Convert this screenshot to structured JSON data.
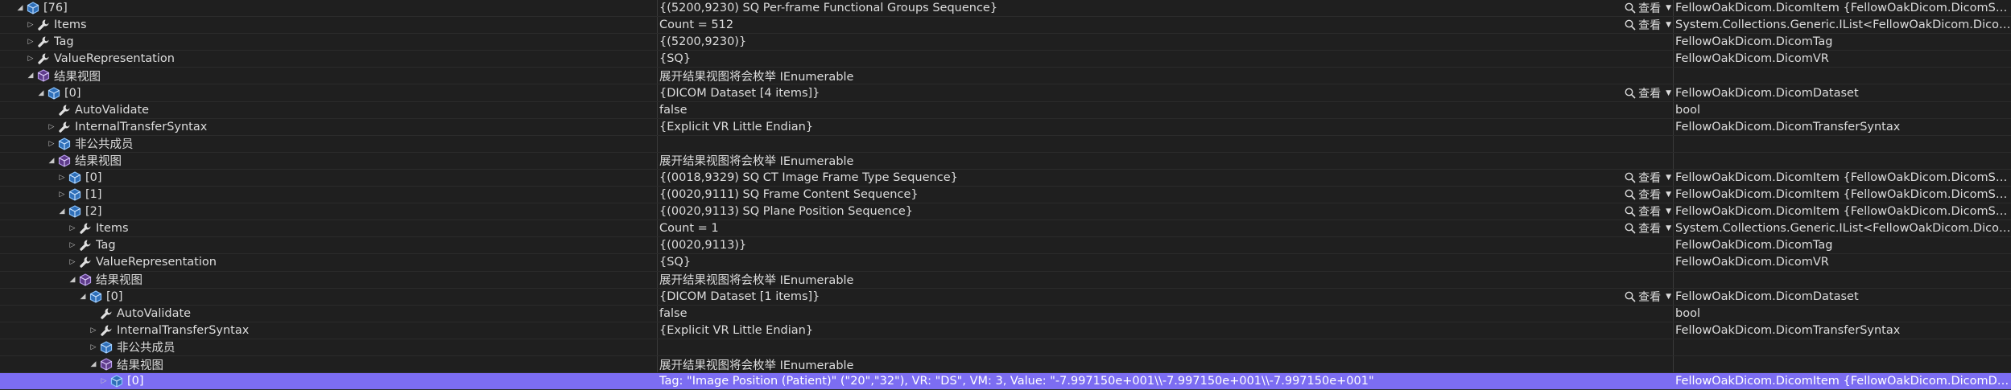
{
  "viewer_label": "查看",
  "rows": [
    {
      "level": 1,
      "exp": "expanded",
      "icon": "cube-blue-icon",
      "name": "[76]",
      "value": "{(5200,9230) SQ Per-frame Functional Groups Sequence}",
      "viewer": true,
      "type": "FellowOakDicom.DicomItem {FellowOakDicom.DicomSequence}"
    },
    {
      "level": 2,
      "exp": "collapsed",
      "icon": "wrench-icon",
      "name": "Items",
      "value": "Count = 512",
      "viewer": true,
      "type": "System.Collections.Generic.IList<FellowOakDicom.DicomDataset>"
    },
    {
      "level": 2,
      "exp": "collapsed",
      "icon": "wrench-icon",
      "name": "Tag",
      "value": "{(5200,9230)}",
      "viewer": false,
      "type": "FellowOakDicom.DicomTag"
    },
    {
      "level": 2,
      "exp": "collapsed",
      "icon": "wrench-icon",
      "name": "ValueRepresentation",
      "value": "{SQ}",
      "viewer": false,
      "type": "FellowOakDicom.DicomVR"
    },
    {
      "level": 2,
      "exp": "expanded",
      "icon": "cube-purple-icon",
      "name": "结果视图",
      "value": "展开结果视图将会枚举 IEnumerable",
      "viewer": false,
      "type": ""
    },
    {
      "level": 3,
      "exp": "expanded",
      "icon": "cube-blue-icon",
      "name": "[0]",
      "value": "{DICOM Dataset [4 items]}",
      "viewer": true,
      "type": "FellowOakDicom.DicomDataset"
    },
    {
      "level": 4,
      "exp": "none",
      "icon": "wrench-icon",
      "name": "AutoValidate",
      "value": "false",
      "viewer": false,
      "type": "bool"
    },
    {
      "level": 4,
      "exp": "collapsed",
      "icon": "wrench-icon",
      "name": "InternalTransferSyntax",
      "value": "{Explicit VR Little Endian}",
      "viewer": false,
      "type": "FellowOakDicom.DicomTransferSyntax"
    },
    {
      "level": 4,
      "exp": "collapsed",
      "icon": "cube-blue-icon",
      "name": "非公共成员",
      "value": "",
      "viewer": false,
      "type": ""
    },
    {
      "level": 4,
      "exp": "expanded",
      "icon": "cube-purple-icon",
      "name": "结果视图",
      "value": "展开结果视图将会枚举 IEnumerable",
      "viewer": false,
      "type": ""
    },
    {
      "level": 5,
      "exp": "collapsed",
      "icon": "cube-blue-icon",
      "name": "[0]",
      "value": "{(0018,9329) SQ CT Image Frame Type Sequence}",
      "viewer": true,
      "type": "FellowOakDicom.DicomItem {FellowOakDicom.DicomSequence}"
    },
    {
      "level": 5,
      "exp": "collapsed",
      "icon": "cube-blue-icon",
      "name": "[1]",
      "value": "{(0020,9111) SQ Frame Content Sequence}",
      "viewer": true,
      "type": "FellowOakDicom.DicomItem {FellowOakDicom.DicomSequence}"
    },
    {
      "level": 5,
      "exp": "expanded",
      "icon": "cube-blue-icon",
      "name": "[2]",
      "value": "{(0020,9113) SQ Plane Position Sequence}",
      "viewer": true,
      "type": "FellowOakDicom.DicomItem {FellowOakDicom.DicomSequence}"
    },
    {
      "level": 6,
      "exp": "collapsed",
      "icon": "wrench-icon",
      "name": "Items",
      "value": "Count = 1",
      "viewer": true,
      "type": "System.Collections.Generic.IList<FellowOakDicom.DicomDataset>"
    },
    {
      "level": 6,
      "exp": "collapsed",
      "icon": "wrench-icon",
      "name": "Tag",
      "value": "{(0020,9113)}",
      "viewer": false,
      "type": "FellowOakDicom.DicomTag"
    },
    {
      "level": 6,
      "exp": "collapsed",
      "icon": "wrench-icon",
      "name": "ValueRepresentation",
      "value": "{SQ}",
      "viewer": false,
      "type": "FellowOakDicom.DicomVR"
    },
    {
      "level": 6,
      "exp": "expanded",
      "icon": "cube-purple-icon",
      "name": "结果视图",
      "value": "展开结果视图将会枚举 IEnumerable",
      "viewer": false,
      "type": ""
    },
    {
      "level": 7,
      "exp": "expanded",
      "icon": "cube-blue-icon",
      "name": "[0]",
      "value": "{DICOM Dataset [1 items]}",
      "viewer": true,
      "type": "FellowOakDicom.DicomDataset"
    },
    {
      "level": 8,
      "exp": "none",
      "icon": "wrench-icon",
      "name": "AutoValidate",
      "value": "false",
      "viewer": false,
      "type": "bool"
    },
    {
      "level": 8,
      "exp": "collapsed",
      "icon": "wrench-icon",
      "name": "InternalTransferSyntax",
      "value": "{Explicit VR Little Endian}",
      "viewer": false,
      "type": "FellowOakDicom.DicomTransferSyntax"
    },
    {
      "level": 8,
      "exp": "collapsed",
      "icon": "cube-blue-icon",
      "name": "非公共成员",
      "value": "",
      "viewer": false,
      "type": ""
    },
    {
      "level": 8,
      "exp": "expanded",
      "icon": "cube-purple-icon",
      "name": "结果视图",
      "value": "展开结果视图将会枚举 IEnumerable",
      "viewer": false,
      "type": ""
    },
    {
      "level": 9,
      "exp": "collapsed",
      "icon": "cube-blue-icon",
      "name": "[0]",
      "value": "Tag: \"Image Position (Patient)\" (\"20\",\"32\"), VR: \"DS\", VM: 3, Value: \"-7.997150e+001\\\\-7.997150e+001\\\\-7.997150e+001\"",
      "viewer": false,
      "type": "FellowOakDicom.DicomItem {FellowOakDicom.DicomDecimalString}",
      "selected": true
    }
  ]
}
